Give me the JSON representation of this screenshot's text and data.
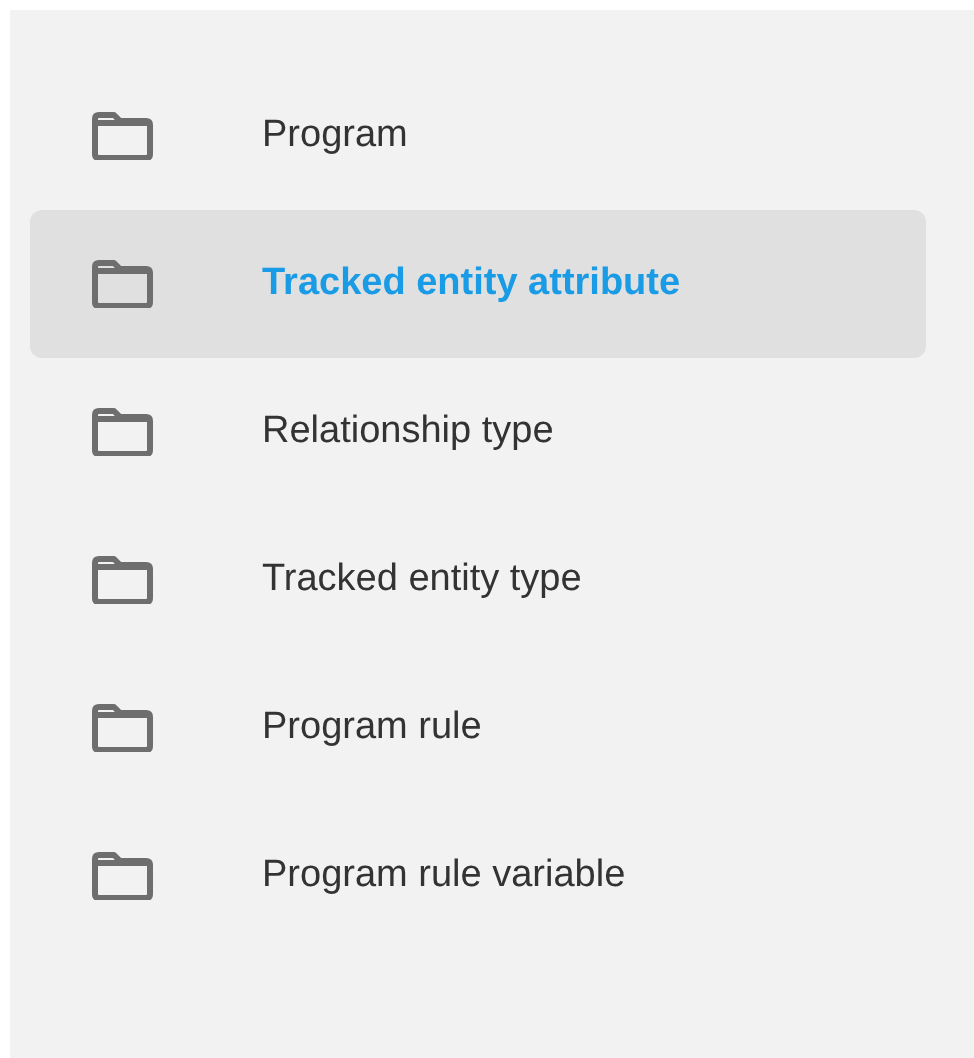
{
  "sidebar": {
    "items": [
      {
        "label": "Program",
        "selected": false
      },
      {
        "label": "Tracked entity attribute",
        "selected": true
      },
      {
        "label": "Relationship type",
        "selected": false
      },
      {
        "label": "Tracked entity type",
        "selected": false
      },
      {
        "label": "Program rule",
        "selected": false
      },
      {
        "label": "Program rule variable",
        "selected": false
      }
    ]
  }
}
